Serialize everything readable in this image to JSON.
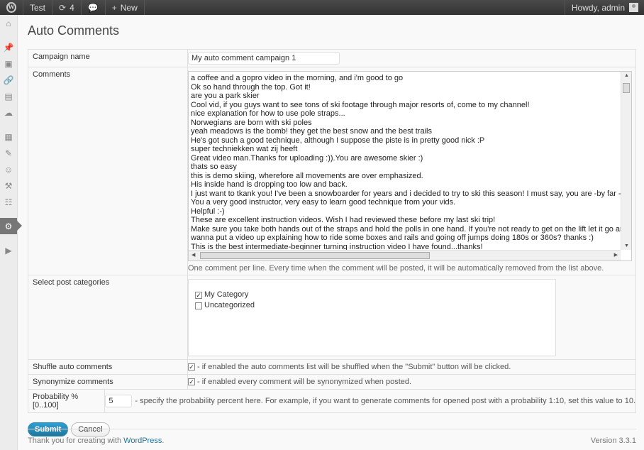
{
  "adminbar": {
    "site_name": "Test",
    "updates_count": "4",
    "new_label": "New",
    "greeting": "Howdy, admin"
  },
  "menu_icons": [
    "dashboard-icon",
    "posts-icon",
    "media-icon",
    "links-icon",
    "pages-icon",
    "comments-icon",
    "appearance-icon",
    "plugins-icon",
    "users-icon",
    "tools-icon",
    "settings-icon",
    "auto-comments-icon",
    "collapse-icon"
  ],
  "page": {
    "title": "Auto Comments"
  },
  "form": {
    "campaign_label": "Campaign name",
    "campaign_value": "My auto comment campaign 1",
    "comments_label": "Comments",
    "comments_lines": [
      "a coffee and a gopro video in the morning, and i'm good to go",
      "Ok so hand through the top. Got it!",
      "are you a park skier",
      "Cool vid, if you guys want to see tons of ski footage through major resorts of, come to my channel!",
      "nice explanation for how to use pole straps...",
      "Norwegians are born with ski poles",
      "yeah meadows is the bomb! they get the best snow and the best trails",
      "He's got such a good technique, although I suppose the piste is in pretty good nick :P",
      "super techniekken wat zij heeft",
      "Great video man.Thanks for uploading :)).You are awesome skier :)",
      "thats so easy",
      "this is demo skiing, wherefore all movements are over emphasized.",
      "His inside hand is dropping too low and back.",
      "I just want to tkank you! I've been a snowboarder for years and i decided to try to ski this season! I must say, you are -by far - the best ski teacher i've ev",
      "You a very good instructor, very easy to learn good technique from your vids.",
      "Helpful :-)",
      "These are excellent instruction videos. Wish I had reviewed these before my last ski trip!",
      "Make sure you take both hands out of the straps and hold the polls in one hand. If you're not ready to get on the lift let it go and get the next one. When",
      "wanna put a video up explaining how to ride some boxes and rails and going off jumps doing 180s or 360s? thanks :)",
      "This is the best intermediate-beginner turning instruction video I have found...thanks!"
    ],
    "comments_help": "One comment per line. Every time when the comment will be posted, it will be automatically removed from the list above.",
    "categories_label": "Select post categories",
    "categories": [
      {
        "name": "My Category",
        "checked": true
      },
      {
        "name": "Uncategorized",
        "checked": false
      }
    ],
    "shuffle_label": "Shuffle auto comments",
    "shuffle_desc": "- if enabled the auto comments list will be shuffled when the \"Submit\" button will be clicked.",
    "shuffle_checked": true,
    "synonymize_label": "Synonymize comments",
    "synonymize_desc": "- if enabled every comment will be synonymized when posted.",
    "synonymize_checked": true,
    "probability_label": "Probability % [0..100]",
    "probability_value": "5",
    "probability_desc": "- specify the probability percent here. For example, if you want to generate comments for opened post with a probability 1:10, set this value to 10."
  },
  "actions": {
    "submit_label": "Submit",
    "cancel_label": "Cancel"
  },
  "footer": {
    "thanks_prefix": "Thank you for creating with",
    "wp_link": "WordPress",
    "period": ".",
    "version": "Version 3.3.1"
  },
  "colors": {
    "accent": "#21759b",
    "adminbar": "#464646"
  }
}
